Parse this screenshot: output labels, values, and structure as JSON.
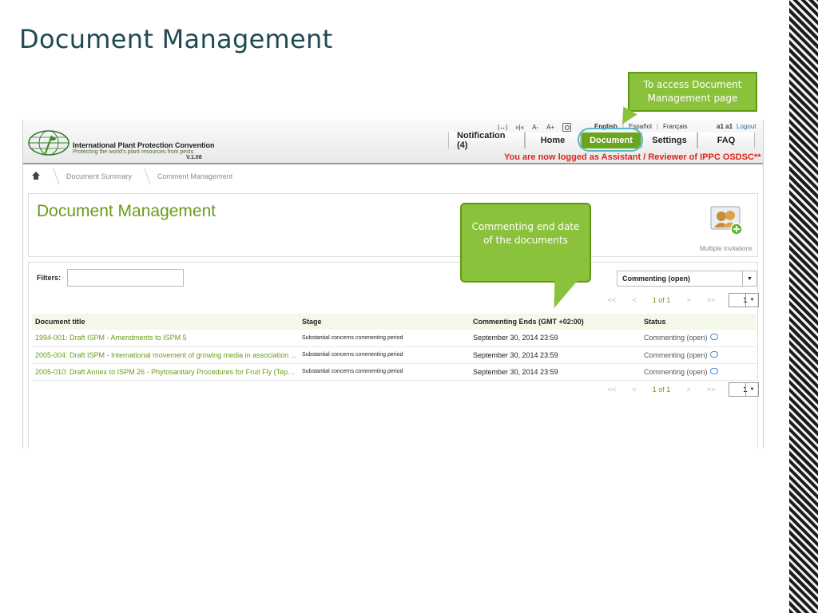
{
  "slide": {
    "title": "Document Management"
  },
  "header": {
    "org_name": "International Plant Protection Convention",
    "org_tagline": "Protecting the world's plant resources from pests",
    "version": "V.1.08",
    "tools": [
      "|↔|",
      "»|«",
      "A-",
      "A+"
    ],
    "languages": [
      "English",
      "Español",
      "Français"
    ],
    "user": "a1 a1",
    "logout": "Logout",
    "nav": {
      "notification": "Notification (4)",
      "home": "Home",
      "document": "Document",
      "settings": "Settings",
      "faq": "FAQ"
    },
    "login_message": "You are now logged as Assistant / Reviewer of IPPC OSDSC**"
  },
  "breadcrumb": [
    "Document Summary",
    "Comment Management"
  ],
  "page": {
    "title": "Document Management",
    "invite_label": "Multiple Invitations"
  },
  "list": {
    "filters_label": "Filters:",
    "filters_value": "",
    "status_filter": "Commenting (open)",
    "pager": {
      "first": "<<",
      "prev": "<",
      "current": "1 of 1",
      "next": ">",
      "last": ">>",
      "page": "1"
    },
    "columns": [
      "Document title",
      "Stage",
      "Commenting Ends (GMT +02:00)",
      "Status"
    ],
    "rows": [
      {
        "title": "1994-001: Draft ISPM - Amendments to ISPM 5",
        "stage": "Substantial concerns commenting period",
        "ends": "September 30, 2014  23:59",
        "status": "Commenting (open)"
      },
      {
        "title": "2005-004: Draft ISPM - International movement of growing media in association ...",
        "stage": "Substantial concerns commenting period",
        "ends": "September 30, 2014  23:59",
        "status": "Commenting (open)"
      },
      {
        "title": "2005-010: Draft Annex to ISPM 26 - Phytosanitary Procedures for Fruit Fly (Tephrit...",
        "stage": "Substantial concerns commenting period",
        "ends": "September 30, 2014  23:59",
        "status": "Commenting (open)"
      }
    ]
  },
  "callouts": {
    "top": "To access Document Management page",
    "mid": "Commenting end date of the documents"
  },
  "colors": {
    "accent_green": "#6aa51e",
    "callout_green": "#8bc23b",
    "highlight_ring": "#56b9c9",
    "alert_red": "#e0231a",
    "slide_title": "#1e4a55"
  },
  "icons": {
    "home": "home-icon",
    "zoom": "zoom-icon",
    "invite": "multiple-invitations-icon",
    "comment": "comment-bubble-icon",
    "logo": "ippc-globe-logo"
  }
}
